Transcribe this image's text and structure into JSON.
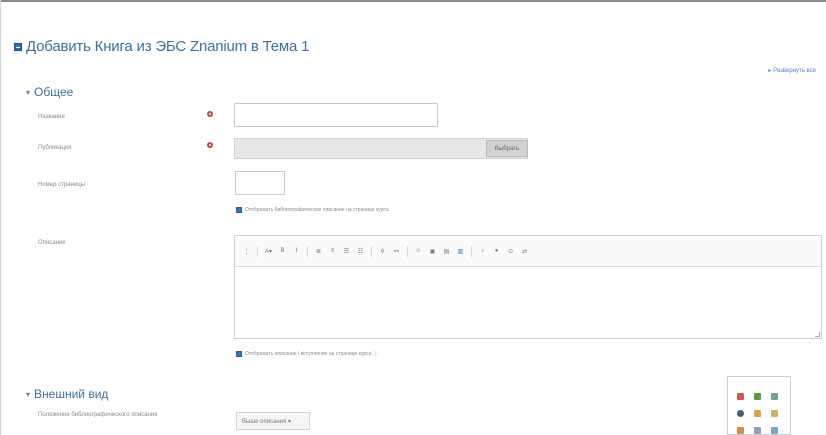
{
  "page": {
    "title": "Добавить Книга из ЭБС Znanium в Тема 1",
    "expand_all": "▸ Развернуть всё"
  },
  "sections": {
    "general": {
      "label": "Общее"
    },
    "appearance": {
      "label": "Внешний вид"
    }
  },
  "fields": {
    "name": {
      "label": "Название",
      "value": ""
    },
    "publication": {
      "label": "Публикация",
      "button_label": "Выбрать"
    },
    "page_number": {
      "label": "Номер страницы",
      "value": ""
    },
    "show_bib_label": "Отображать библиографическое описание на странице курса",
    "description": {
      "label": "Описание"
    },
    "show_desc_label": "Отображать описание / вступление на странице курса ⓘ",
    "bib_position": {
      "label": "Положение библиографического описания",
      "selected": "Выше описания ▾"
    }
  },
  "editor": {
    "toolbar": [
      {
        "name": "toolbar-toggle-icon",
        "glyph": "⋮"
      },
      {
        "name": "font-size-icon",
        "glyph": "A▾"
      },
      {
        "name": "bold-icon",
        "glyph": "B"
      },
      {
        "name": "italic-icon",
        "glyph": "I"
      },
      {
        "name": "bullet-list-icon",
        "glyph": "≣"
      },
      {
        "name": "numbered-list-icon",
        "glyph": "≡"
      },
      {
        "name": "align-left-icon",
        "glyph": "☰"
      },
      {
        "name": "align-right-icon",
        "glyph": "☷"
      },
      {
        "name": "link-icon",
        "glyph": "⚲"
      },
      {
        "name": "unlink-icon",
        "glyph": "⚯"
      },
      {
        "name": "emoji-icon",
        "glyph": "☺"
      },
      {
        "name": "image-icon",
        "glyph": "▣"
      },
      {
        "name": "media-icon",
        "glyph": "▤"
      },
      {
        "name": "file-icon",
        "glyph": "▥"
      },
      {
        "name": "record-audio-icon",
        "glyph": "♪"
      },
      {
        "name": "record-video-icon",
        "glyph": "●"
      },
      {
        "name": "manage-files-icon",
        "glyph": "⊙"
      },
      {
        "name": "accessibility-icon",
        "glyph": "⇄"
      }
    ]
  },
  "colors": {
    "accent": "#3f6f9f",
    "required": "#c64545",
    "checkbox": "#3b73b5"
  }
}
